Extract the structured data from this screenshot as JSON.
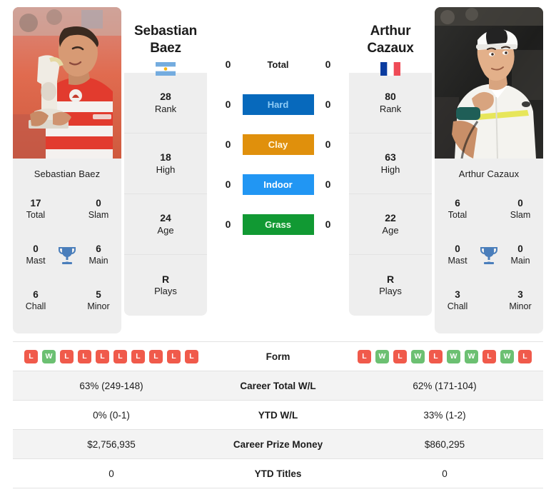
{
  "players": {
    "left": {
      "first_name": "Sebastian",
      "last_name": "Baez",
      "full_name": "Sebastian Baez",
      "flag": "argentina-flag",
      "photo": "player-photo-kissing-trophy",
      "rank": "28",
      "rank_label": "Rank",
      "high": "18",
      "high_label": "High",
      "age": "24",
      "age_label": "Age",
      "plays": "R",
      "plays_label": "Plays",
      "titles": {
        "total": "17",
        "total_label": "Total",
        "slam": "0",
        "slam_label": "Slam",
        "mast": "0",
        "mast_label": "Mast",
        "main": "6",
        "main_label": "Main",
        "chall": "6",
        "chall_label": "Chall",
        "minor": "5",
        "minor_label": "Minor"
      },
      "form": [
        "L",
        "W",
        "L",
        "L",
        "L",
        "L",
        "L",
        "L",
        "L",
        "L"
      ],
      "career_wl": "63% (249-148)",
      "ytd_wl": "0% (0-1)",
      "prize_money": "$2,756,935",
      "ytd_titles": "0",
      "surface_scores": {
        "total": "0",
        "hard": "0",
        "clay": "0",
        "indoor": "0",
        "grass": "0"
      }
    },
    "right": {
      "first_name": "Arthur",
      "last_name": "Cazaux",
      "full_name": "Arthur Cazaux",
      "flag": "france-flag",
      "photo": "player-photo-fist-pump",
      "rank": "80",
      "rank_label": "Rank",
      "high": "63",
      "high_label": "High",
      "age": "22",
      "age_label": "Age",
      "plays": "R",
      "plays_label": "Plays",
      "titles": {
        "total": "6",
        "total_label": "Total",
        "slam": "0",
        "slam_label": "Slam",
        "mast": "0",
        "mast_label": "Mast",
        "main": "0",
        "main_label": "Main",
        "chall": "3",
        "chall_label": "Chall",
        "minor": "3",
        "minor_label": "Minor"
      },
      "form": [
        "L",
        "W",
        "L",
        "W",
        "L",
        "W",
        "W",
        "L",
        "W",
        "L"
      ],
      "career_wl": "62% (171-104)",
      "ytd_wl": "33% (1-2)",
      "prize_money": "$860,295",
      "ytd_titles": "0",
      "surface_scores": {
        "total": "0",
        "hard": "0",
        "clay": "0",
        "indoor": "0",
        "grass": "0"
      }
    }
  },
  "surfaces": [
    {
      "key": "total",
      "label": "Total",
      "color": "",
      "text_color": "#1c1c1c",
      "badge": false
    },
    {
      "key": "hard",
      "label": "Hard",
      "color": "#0769BC",
      "text_color": "#8ecbf5",
      "badge": true
    },
    {
      "key": "clay",
      "label": "Clay",
      "color": "#E0900C",
      "text_color": "#fff6e0",
      "badge": true
    },
    {
      "key": "indoor",
      "label": "Indoor",
      "color": "#2196F3",
      "text_color": "#ffffff",
      "badge": true
    },
    {
      "key": "grass",
      "label": "Grass",
      "color": "#119933",
      "text_color": "#eafbe9",
      "badge": true
    }
  ],
  "table": {
    "rows": [
      {
        "label": "Form",
        "type": "form",
        "shade": false
      },
      {
        "label": "Career Total W/L",
        "type": "text",
        "shade": true,
        "key": "career_wl"
      },
      {
        "label": "YTD W/L",
        "type": "text",
        "shade": false,
        "key": "ytd_wl"
      },
      {
        "label": "Career Prize Money",
        "type": "text",
        "shade": true,
        "key": "prize_money"
      },
      {
        "label": "YTD Titles",
        "type": "text",
        "shade": false,
        "key": "ytd_titles"
      }
    ]
  },
  "icons": {
    "trophy": "trophy-icon"
  },
  "colors": {
    "win": "#6cc072",
    "loss": "#f05a4b",
    "panel": "#eeeeee",
    "row_shade": "#f3f3f3"
  }
}
